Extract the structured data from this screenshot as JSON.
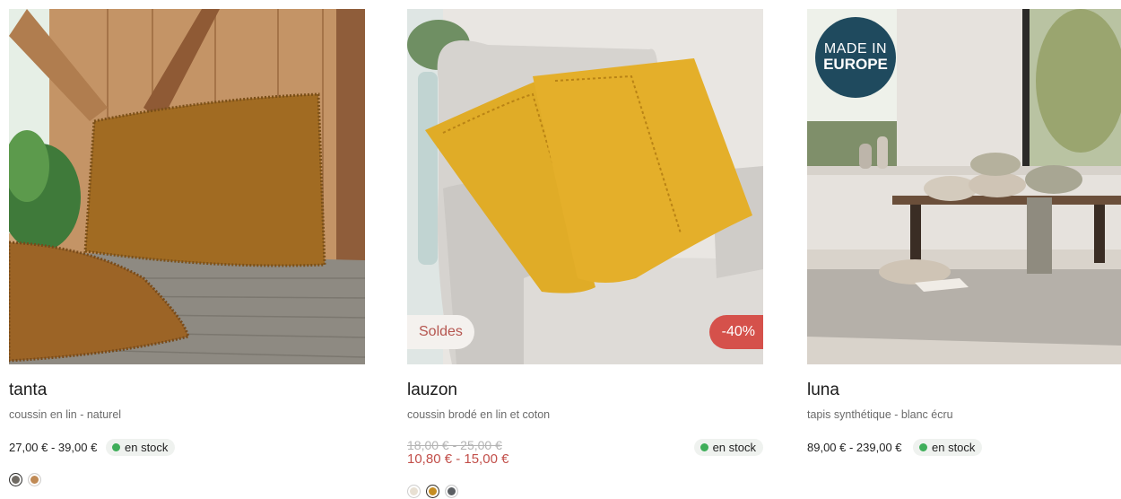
{
  "products": [
    {
      "name": "tanta",
      "description": "coussin en lin - naturel",
      "price": "27,00 € - 39,00 €",
      "stock": "en stock",
      "swatches": [
        {
          "color": "#6f6a63",
          "active": true
        },
        {
          "color": "#c08a55",
          "active": false
        }
      ]
    },
    {
      "name": "lauzon",
      "description": "coussin brodé en lin et coton",
      "old_price": "18,00 € - 25,00 €",
      "sale_price": "10,80 € - 15,00 €",
      "stock": "en stock",
      "badge_left": "Soldes",
      "badge_right": "-40%",
      "swatches": [
        {
          "color": "#e8e0d3",
          "active": false
        },
        {
          "color": "#c58d22",
          "active": true
        },
        {
          "color": "#5b5f63",
          "active": false
        }
      ]
    },
    {
      "name": "luna",
      "description": "tapis synthétique - blanc écru",
      "price": "89,00 € - 239,00 €",
      "stock": "en stock",
      "badge_line1": "MADE IN",
      "badge_line2": "EUROPE"
    }
  ],
  "colors": {
    "stock_dot": "#3fae5a",
    "sale_price": "#c24f4a",
    "discount_badge": "#d5514b",
    "made_in_badge": "#1f4a5e"
  },
  "icons": [
    "stock-status-dot-icon"
  ]
}
